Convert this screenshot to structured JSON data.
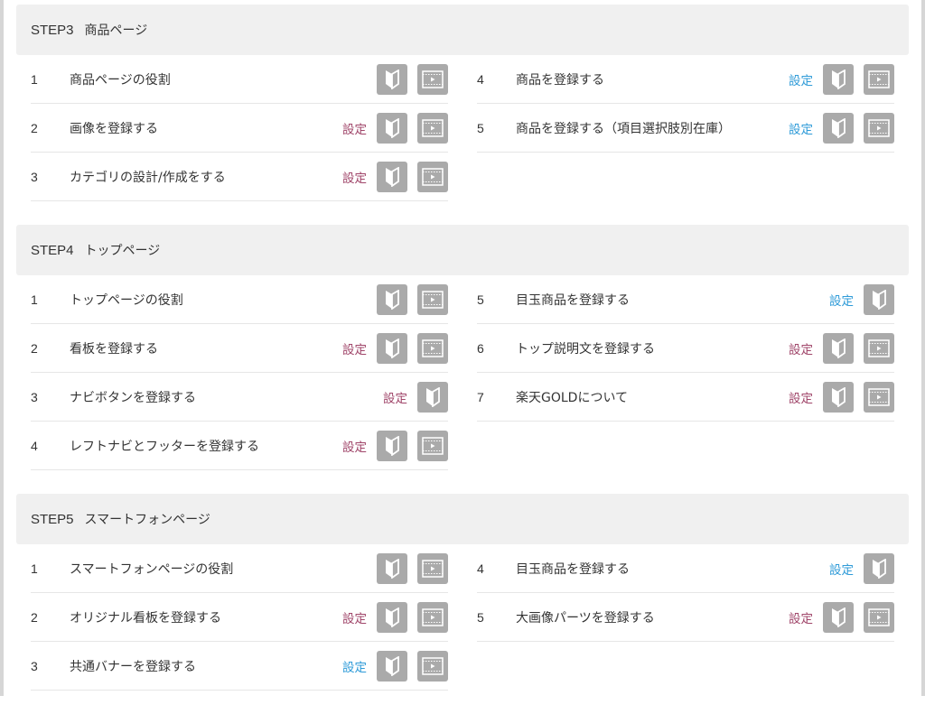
{
  "settings_label": "設定",
  "colors": {
    "pink": "#a0466a",
    "blue": "#2f9bd8",
    "icon_bg": "#aaaaaa",
    "header_bg": "#f0f0f0"
  },
  "steps": [
    {
      "code": "STEP3",
      "title": "商品ページ",
      "left": [
        {
          "num": "1",
          "label": "商品ページの役割",
          "setting": null,
          "icons": [
            "beginner-icon",
            "video-icon"
          ]
        },
        {
          "num": "2",
          "label": "画像を登録する",
          "setting": "pink",
          "icons": [
            "beginner-icon",
            "video-icon"
          ]
        },
        {
          "num": "3",
          "label": "カテゴリの設計/作成をする",
          "setting": "pink",
          "icons": [
            "beginner-icon",
            "video-icon"
          ]
        }
      ],
      "right": [
        {
          "num": "4",
          "label": "商品を登録する",
          "setting": "blue",
          "icons": [
            "beginner-icon",
            "video-icon"
          ]
        },
        {
          "num": "5",
          "label": "商品を登録する（項目選択肢別在庫）",
          "setting": "blue",
          "icons": [
            "beginner-icon",
            "video-icon"
          ]
        }
      ]
    },
    {
      "code": "STEP4",
      "title": "トップページ",
      "left": [
        {
          "num": "1",
          "label": "トップページの役割",
          "setting": null,
          "icons": [
            "beginner-icon",
            "video-icon"
          ]
        },
        {
          "num": "2",
          "label": "看板を登録する",
          "setting": "pink",
          "icons": [
            "beginner-icon",
            "video-icon"
          ]
        },
        {
          "num": "3",
          "label": "ナビボタンを登録する",
          "setting": "pink",
          "icons": [
            "beginner-icon"
          ]
        },
        {
          "num": "4",
          "label": "レフトナビとフッターを登録する",
          "setting": "pink",
          "icons": [
            "beginner-icon",
            "video-icon"
          ]
        }
      ],
      "right": [
        {
          "num": "5",
          "label": "目玉商品を登録する",
          "setting": "blue",
          "icons": [
            "beginner-icon"
          ]
        },
        {
          "num": "6",
          "label": "トップ説明文を登録する",
          "setting": "pink",
          "icons": [
            "beginner-icon",
            "video-icon"
          ]
        },
        {
          "num": "7",
          "label": "楽天GOLDについて",
          "setting": "pink",
          "icons": [
            "beginner-icon",
            "video-icon"
          ]
        }
      ]
    },
    {
      "code": "STEP5",
      "title": "スマートフォンページ",
      "left": [
        {
          "num": "1",
          "label": "スマートフォンページの役割",
          "setting": null,
          "icons": [
            "beginner-icon",
            "video-icon"
          ]
        },
        {
          "num": "2",
          "label": "オリジナル看板を登録する",
          "setting": "pink",
          "icons": [
            "beginner-icon",
            "video-icon"
          ]
        },
        {
          "num": "3",
          "label": "共通バナーを登録する",
          "setting": "blue",
          "icons": [
            "beginner-icon",
            "video-icon"
          ]
        }
      ],
      "right": [
        {
          "num": "4",
          "label": "目玉商品を登録する",
          "setting": "blue",
          "icons": [
            "beginner-icon"
          ]
        },
        {
          "num": "5",
          "label": "大画像パーツを登録する",
          "setting": "pink",
          "icons": [
            "beginner-icon",
            "video-icon"
          ]
        }
      ]
    }
  ]
}
